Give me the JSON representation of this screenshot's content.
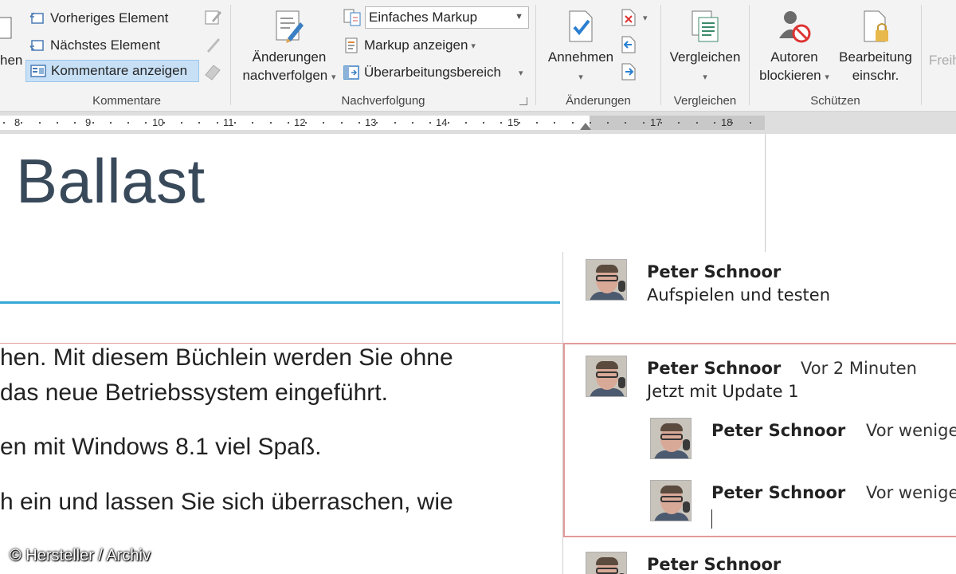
{
  "ribbon": {
    "partial_left": "hen",
    "comments_group": {
      "prev": "Vorheriges Element",
      "next": "Nächstes Element",
      "show": "Kommentare anzeigen",
      "label": "Kommentare"
    },
    "tracking_group": {
      "track_line1": "Änderungen",
      "track_line2": "nachverfolgen",
      "markup_combo": "Einfaches Markup",
      "show_markup": "Markup anzeigen",
      "review_pane": "Überarbeitungsbereich",
      "label": "Nachverfolgung"
    },
    "changes_group": {
      "accept": "Annehmen",
      "label": "Änderungen"
    },
    "compare_group": {
      "compare": "Vergleichen",
      "label": "Vergleichen"
    },
    "protect_group": {
      "block_line1": "Autoren",
      "block_line2": "blockieren",
      "restrict_line1": "Bearbeitung",
      "restrict_line2": "einschr.",
      "label": "Schützen"
    },
    "partial_right": "Freih"
  },
  "ruler": {
    "numbers": [
      "8",
      "9",
      "10",
      "11",
      "12",
      "13",
      "14",
      "15",
      "17",
      "18"
    ]
  },
  "document": {
    "heading": "Ballast",
    "lines": [
      "hen. Mit diesem Büchlein werden Sie ohne",
      "das neue Betriebssystem eingeführt.",
      "en mit Windows 8.1 viel Spaß.",
      "h ein und lassen Sie sich überraschen, wie"
    ]
  },
  "comments": [
    {
      "author": "Peter Schnoor",
      "time": "",
      "text": "Aufspielen und testen"
    },
    {
      "author": "Peter Schnoor",
      "time": "Vor 2 Minuten",
      "text": "Jetzt mit Update 1"
    },
    {
      "author": "Peter Schnoor",
      "time": "Vor wenige",
      "text": ""
    },
    {
      "author": "Peter Schnoor",
      "time": "Vor wenige",
      "text": ""
    },
    {
      "author": "Peter Schnoor",
      "time": "",
      "text": ""
    }
  ],
  "credit": "© Hersteller / Archiv",
  "colors": {
    "heading": "#38495a",
    "rule": "#35a7d6",
    "comment_highlight": "#e39a9a",
    "selected_button": "#c8e0f6"
  }
}
